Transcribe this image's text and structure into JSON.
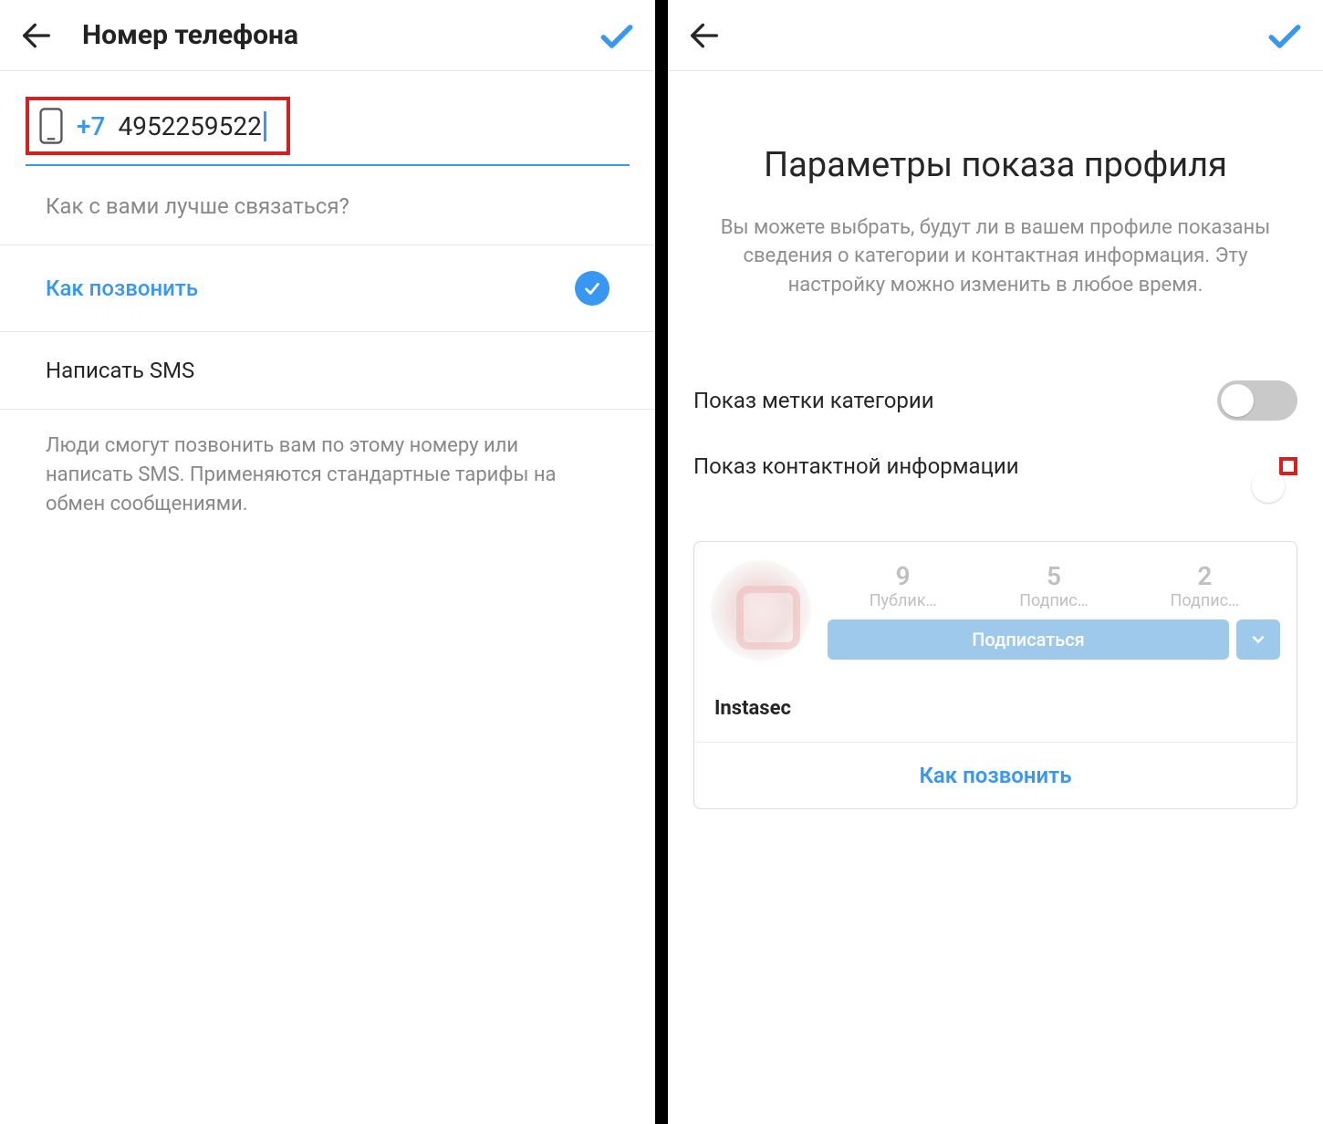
{
  "left": {
    "header_title": "Номер телефона",
    "country_code": "+7",
    "phone_number": "4952259522",
    "contact_question": "Как с вами лучше связаться?",
    "option_call": "Как позвонить",
    "option_sms": "Написать SMS",
    "help_text": "Люди смогут позвонить вам по этому номеру или написать SMS. Применяются стандартные тарифы на обмен сообщениями."
  },
  "right": {
    "title": "Параметры показа профиля",
    "description": "Вы можете выбрать, будут ли в вашем профиле показаны сведения о категории и контактная информация. Эту настройку можно изменить в любое время.",
    "toggle_category_label": "Показ метки категории",
    "toggle_contact_label": "Показ контактной информации",
    "preview": {
      "posts_count": "9",
      "followers_count": "5",
      "following_count": "2",
      "posts_label": "Публик…",
      "followers_label": "Подпис…",
      "following_label": "Подпис…",
      "follow_button": "Подписаться",
      "profile_name": "Instasec",
      "call_link": "Как позвонить"
    }
  },
  "colors": {
    "accent": "#3897f0",
    "highlight": "#d22121"
  }
}
